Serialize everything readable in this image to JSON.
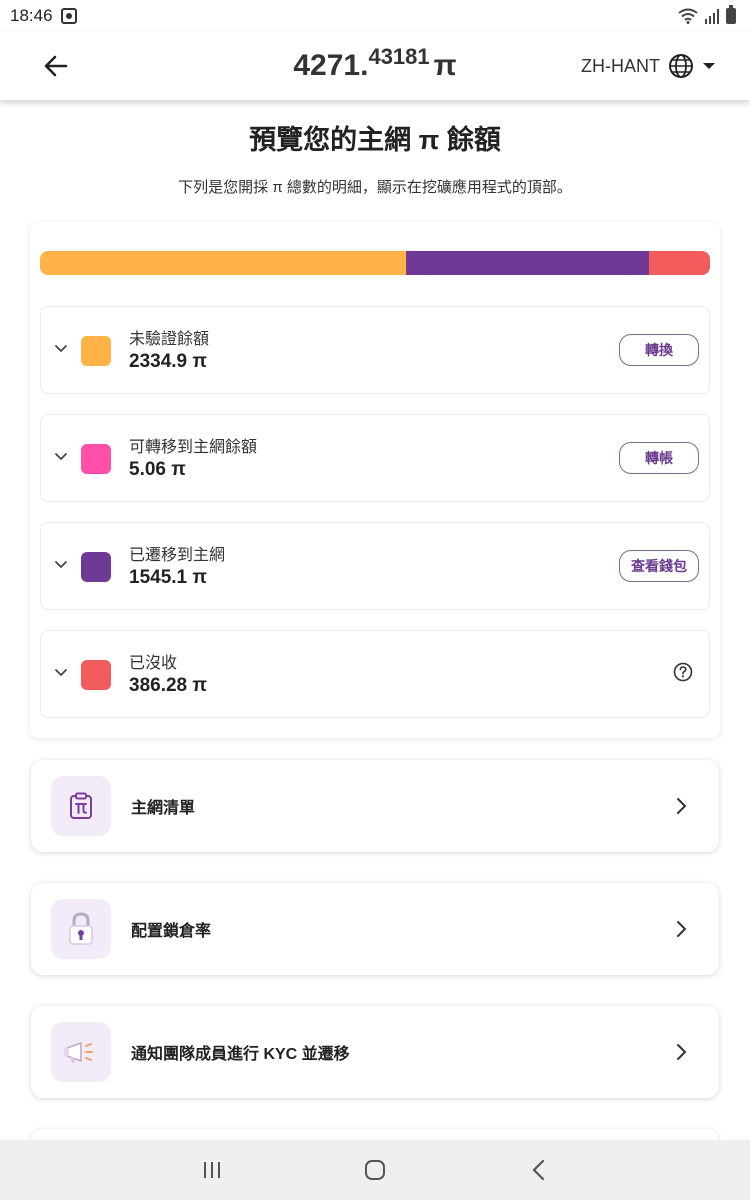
{
  "status_bar": {
    "time": "18:46"
  },
  "header": {
    "balance_whole": "4271.",
    "balance_fraction": "43181",
    "balance_unit": "π",
    "language": "ZH-HANT"
  },
  "page": {
    "title": "預覽您的主網 π 餘額",
    "subtitle": "下列是您開採 π 總數的明細，顯示在挖礦應用程式的頂部。"
  },
  "balance_bar": {
    "segments": [
      {
        "name": "unverified",
        "fraction": 0.547,
        "color": "#FFB347"
      },
      {
        "name": "migrated",
        "fraction": 0.362,
        "color": "#6E3A96"
      },
      {
        "name": "forfeited",
        "fraction": 0.091,
        "color": "#F25C5C"
      }
    ]
  },
  "balances": [
    {
      "label": "未驗證餘額",
      "amount": "2334.9 π",
      "color": "#FFB347",
      "action": "轉換"
    },
    {
      "label": "可轉移到主網餘額",
      "amount": "5.06 π",
      "color": "#FF4FA8",
      "action": "轉帳"
    },
    {
      "label": "已遷移到主網",
      "amount": "1545.1 π",
      "color": "#6E3A96",
      "action": "查看錢包"
    },
    {
      "label": "已沒收",
      "amount": "386.28 π",
      "color": "#F25C5C",
      "action": ""
    }
  ],
  "menu": [
    {
      "label": "主網清單",
      "icon": "clipboard-pi-icon"
    },
    {
      "label": "配置鎖倉率",
      "icon": "padlock-icon"
    },
    {
      "label": "通知團隊成員進行 KYC 並遷移",
      "icon": "megaphone-icon"
    }
  ],
  "icons": {
    "back": "arrow-left-icon",
    "globe": "globe-icon",
    "dropdown": "caret-down-icon",
    "expand": "chevron-down-icon",
    "help": "question-circle-icon",
    "menu_arrow": "chevron-right-icon",
    "nav_recents": "recents-icon",
    "nav_home": "home-icon",
    "nav_back": "nav-back-icon"
  }
}
